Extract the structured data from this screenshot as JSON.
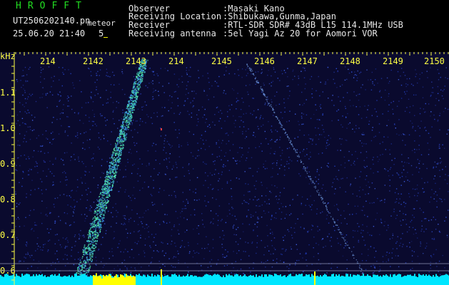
{
  "header": {
    "brand": "HROFFT",
    "file": "UT2506202140.pn",
    "file_tag": "meteor",
    "date": "25.06.20 21:40",
    "interval": "5",
    "fields": [
      {
        "label": "Observer",
        "value": ":Masaki Kano"
      },
      {
        "label": "Receiving Location",
        "value": ":Shibukawa,Gunma,Japan"
      },
      {
        "label": "Receiver",
        "value": ":RTL-SDR SDR# 43dB L15 114.1MHz USB"
      },
      {
        "label": "Receiving antenna",
        "value": ":5el Yagi Az 20 for Aomori VOR"
      }
    ]
  },
  "axes": {
    "y_unit": "kHz",
    "y_ticks": [
      "1.1",
      "1.0",
      "0.9",
      "0.8",
      "0.7",
      "0.6"
    ],
    "x_ticks": [
      "214",
      "2142",
      "2143",
      "214",
      "2145",
      "2146",
      "2147",
      "2148",
      "2149",
      "2150"
    ]
  },
  "colors": {
    "background": "#0a0a2e",
    "noise": "#1f3bb0",
    "echo": "#3fd0c0",
    "axis": "#ffff44",
    "spectrum": "#00e6ff",
    "spectrum_peak": "#ffff00"
  }
}
